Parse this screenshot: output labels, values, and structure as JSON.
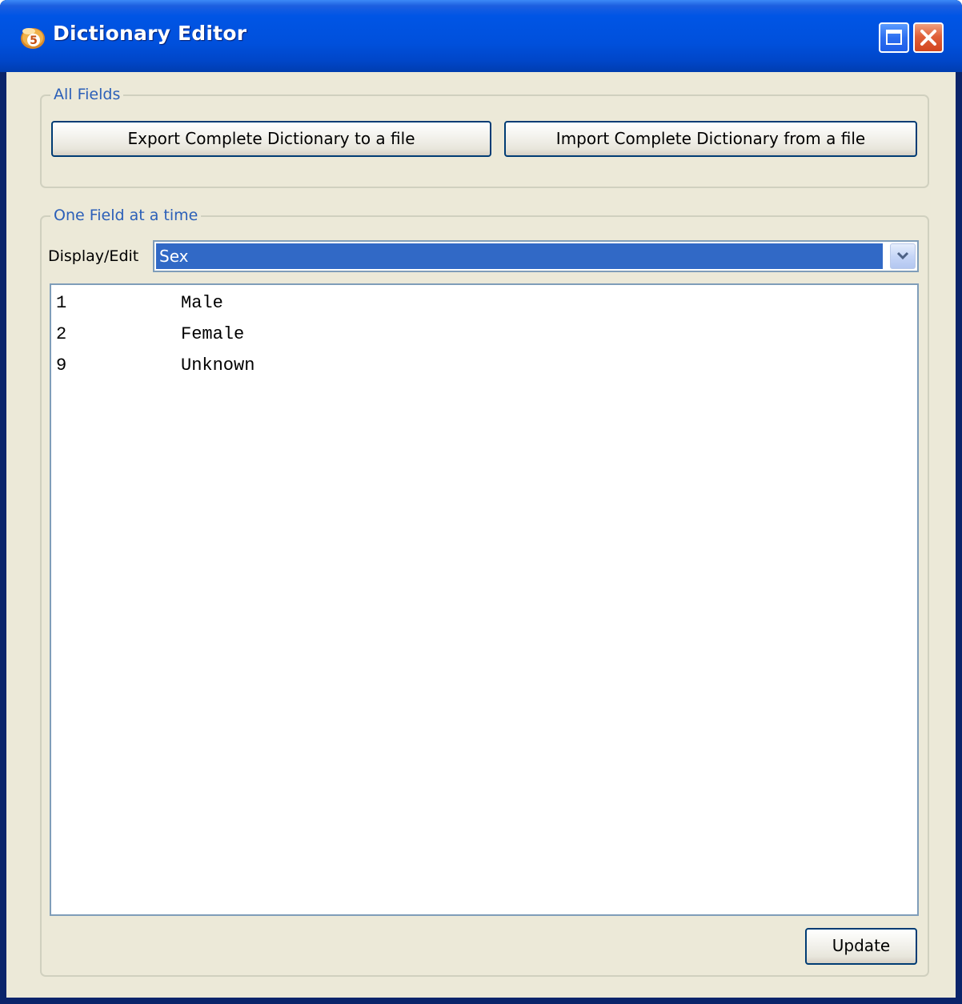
{
  "window": {
    "title": "Dictionary Editor",
    "icon": "cansas-app-icon",
    "controls": [
      "maximize-icon",
      "close-icon"
    ]
  },
  "all_fields": {
    "legend": "All Fields",
    "export_label": "Export Complete Dictionary to a file",
    "import_label": "Import Complete Dictionary from a file"
  },
  "one_field": {
    "legend": "One Field at a time",
    "display_edit_label": "Display/Edit",
    "selected_field": "Sex",
    "entries": [
      {
        "code": "1",
        "label": "Male"
      },
      {
        "code": "2",
        "label": "Female"
      },
      {
        "code": "9",
        "label": "Unknown"
      }
    ],
    "update_label": "Update"
  },
  "colors": {
    "titlebar": "#0054e3",
    "window_bg": "#ece9d8",
    "legend_text": "#2b5fb8",
    "selection": "#3169c6",
    "close_button": "#d2451e"
  }
}
